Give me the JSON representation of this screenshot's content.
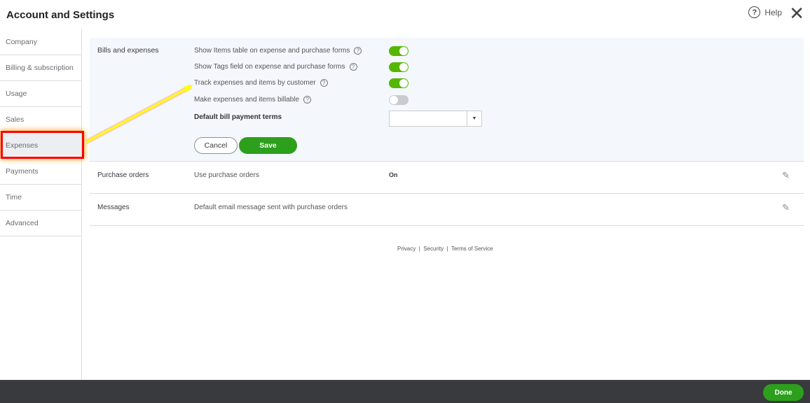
{
  "header": {
    "title": "Account and Settings",
    "help": "Help"
  },
  "sidebar": {
    "items": [
      "Company",
      "Billing & subscription",
      "Usage",
      "Sales",
      "Expenses",
      "Payments",
      "Time",
      "Advanced"
    ]
  },
  "bills": {
    "title": "Bills and expenses",
    "options": [
      {
        "label": "Show Items table on expense and purchase forms",
        "on": true
      },
      {
        "label": "Show Tags field on expense and purchase forms",
        "on": true
      },
      {
        "label": "Track expenses and items by customer",
        "on": true
      },
      {
        "label": "Make expenses and items billable",
        "on": false
      }
    ],
    "terms_label": "Default bill payment terms",
    "terms_value": "",
    "cancel": "Cancel",
    "save": "Save"
  },
  "purchase": {
    "title": "Purchase orders",
    "desc": "Use purchase orders",
    "value": "On"
  },
  "messages": {
    "title": "Messages",
    "desc": "Default email message sent with purchase orders"
  },
  "footer": {
    "privacy": "Privacy",
    "security": "Security",
    "terms": "Terms of Service",
    "sep": "|"
  },
  "bottom": {
    "done": "Done"
  }
}
